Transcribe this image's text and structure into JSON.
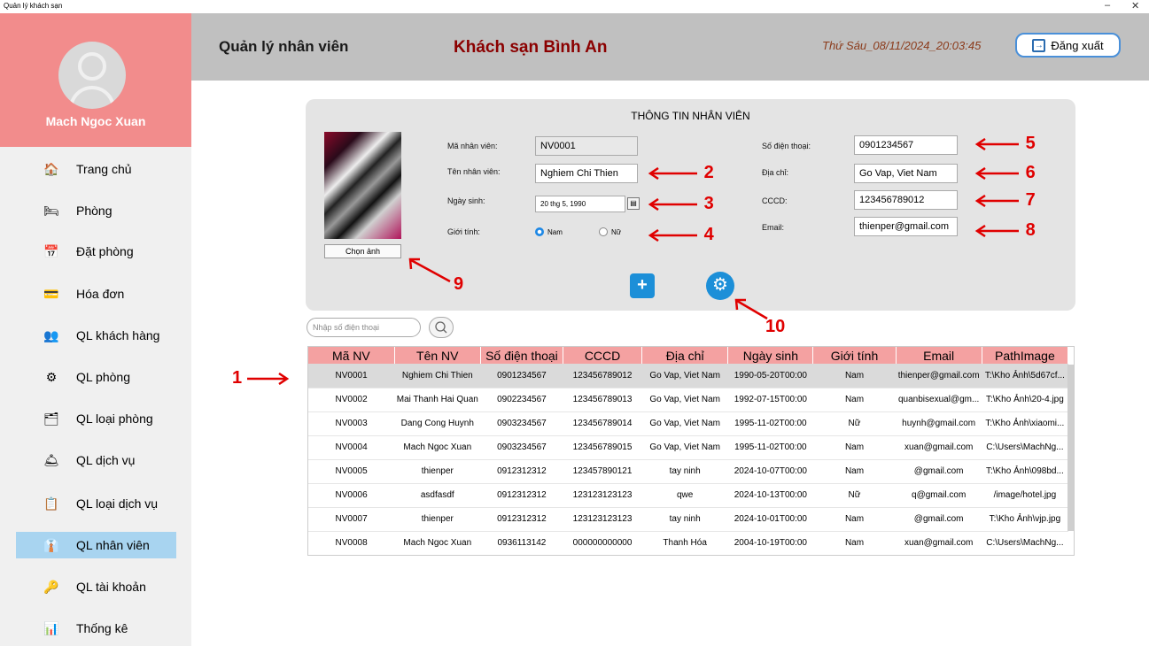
{
  "window": {
    "title": "Quản lý khách sạn",
    "minimize": "–",
    "close": "✕"
  },
  "user": {
    "name": "Mach Ngoc Xuan"
  },
  "sidebar": {
    "items": [
      {
        "label": "Trang chủ",
        "icon": "home-icon",
        "glyph": "🏠"
      },
      {
        "label": "Phòng",
        "icon": "room-icon",
        "glyph": "🛏"
      },
      {
        "label": "Đặt phòng",
        "icon": "booking-icon",
        "glyph": "📅"
      },
      {
        "label": "Hóa đơn",
        "icon": "invoice-icon",
        "glyph": "💳"
      },
      {
        "label": "QL khách hàng",
        "icon": "customers-icon",
        "glyph": "👥"
      },
      {
        "label": "QL phòng",
        "icon": "manage-rooms-icon",
        "glyph": "⚙"
      },
      {
        "label": "QL loại phòng",
        "icon": "room-types-icon",
        "glyph": "🗂"
      },
      {
        "label": "QL dịch vụ",
        "icon": "services-icon",
        "glyph": "🛎"
      },
      {
        "label": "QL loại dịch vụ",
        "icon": "service-types-icon",
        "glyph": "📋"
      },
      {
        "label": "QL nhân viên",
        "icon": "employees-icon",
        "glyph": "👔"
      },
      {
        "label": "QL tài khoản",
        "icon": "accounts-icon",
        "glyph": "🔑"
      },
      {
        "label": "Thống kê",
        "icon": "statistics-icon",
        "glyph": "📊"
      }
    ]
  },
  "header": {
    "title": "Quản lý nhân viên",
    "hotel": "Khách sạn Bình An",
    "datetime": "Thứ Sáu_08/11/2024_20:03:45",
    "logout_label": "Đăng xuất"
  },
  "form": {
    "title": "THÔNG TIN NHÂN VIÊN",
    "choose_image": "Chọn ảnh",
    "labels": {
      "id": "Mã nhân viên:",
      "name": "Tên nhân viên:",
      "dob": "Ngày sinh:",
      "gender": "Giới tính:",
      "phone": "Số điện thoại:",
      "address": "Địa chỉ:",
      "cccd": "CCCD:",
      "email": "Email:"
    },
    "values": {
      "id": "NV0001",
      "name": "Nghiem Chi Thien",
      "dob": "20 thg 5, 1990",
      "phone": "0901234567",
      "address": "Go Vap, Viet Nam",
      "cccd": "123456789012",
      "email": "thienper@gmail.com"
    },
    "gender_options": [
      "Nam",
      "Nữ"
    ],
    "gender_selected": "Nam"
  },
  "annotations": [
    "1",
    "2",
    "3",
    "4",
    "5",
    "6",
    "7",
    "8",
    "9",
    "10"
  ],
  "search": {
    "placeholder": "Nhập số điện thoại"
  },
  "table": {
    "columns": [
      "Mã NV",
      "Tên NV",
      "Số điện thoại",
      "CCCD",
      "Địa chỉ",
      "Ngày sinh",
      "Giới tính",
      "Email",
      "PathImage"
    ],
    "rows": [
      [
        "NV0001",
        "Nghiem Chi Thien",
        "0901234567",
        "123456789012",
        "Go Vap, Viet Nam",
        "1990-05-20T00:00",
        "Nam",
        "thienper@gmail.com",
        "T:\\Kho Ảnh\\5d67cf..."
      ],
      [
        "NV0002",
        "Mai Thanh Hai Quan",
        "0902234567",
        "123456789013",
        "Go Vap, Viet Nam",
        "1992-07-15T00:00",
        "Nam",
        "quanbisexual@gm...",
        "T:\\Kho Ảnh\\20-4.jpg"
      ],
      [
        "NV0003",
        "Dang Cong Huynh",
        "0903234567",
        "123456789014",
        "Go Vap, Viet Nam",
        "1995-11-02T00:00",
        "Nữ",
        "huynh@gmail.com",
        "T:\\Kho Ảnh\\xiaomi..."
      ],
      [
        "NV0004",
        "Mach Ngoc Xuan",
        "0903234567",
        "123456789015",
        "Go Vap, Viet Nam",
        "1995-11-02T00:00",
        "Nam",
        "xuan@gmail.com",
        "C:\\Users\\MachNg..."
      ],
      [
        "NV0005",
        "thienper",
        "0912312312",
        "123457890121",
        "tay ninh",
        "2024-10-07T00:00",
        "Nam",
        "@gmail.com",
        "T:\\Kho Ảnh\\098bd..."
      ],
      [
        "NV0006",
        "asdfasdf",
        "0912312312",
        "123123123123",
        "qwe",
        "2024-10-13T00:00",
        "Nữ",
        "q@gmail.com",
        "/image/hotel.jpg"
      ],
      [
        "NV0007",
        "thienper",
        "0912312312",
        "123123123123",
        "tay ninh",
        "2024-10-01T00:00",
        "Nam",
        "@gmail.com",
        "T:\\Kho Ảnh\\vjp.jpg"
      ],
      [
        "NV0008",
        "Mach Ngoc Xuan",
        "0936113142",
        "000000000000",
        "Thanh Hóa",
        "2004-10-19T00:00",
        "Nam",
        "xuan@gmail.com",
        "C:\\Users\\MachNg..."
      ]
    ]
  },
  "colors": {
    "accent": "#f28c8c",
    "header_bg": "#c0c0c0",
    "active_menu": "#a8d4f0",
    "hotel_name": "#8b0000",
    "annotation": "#e00000",
    "button_blue": "#1c8fd8"
  }
}
